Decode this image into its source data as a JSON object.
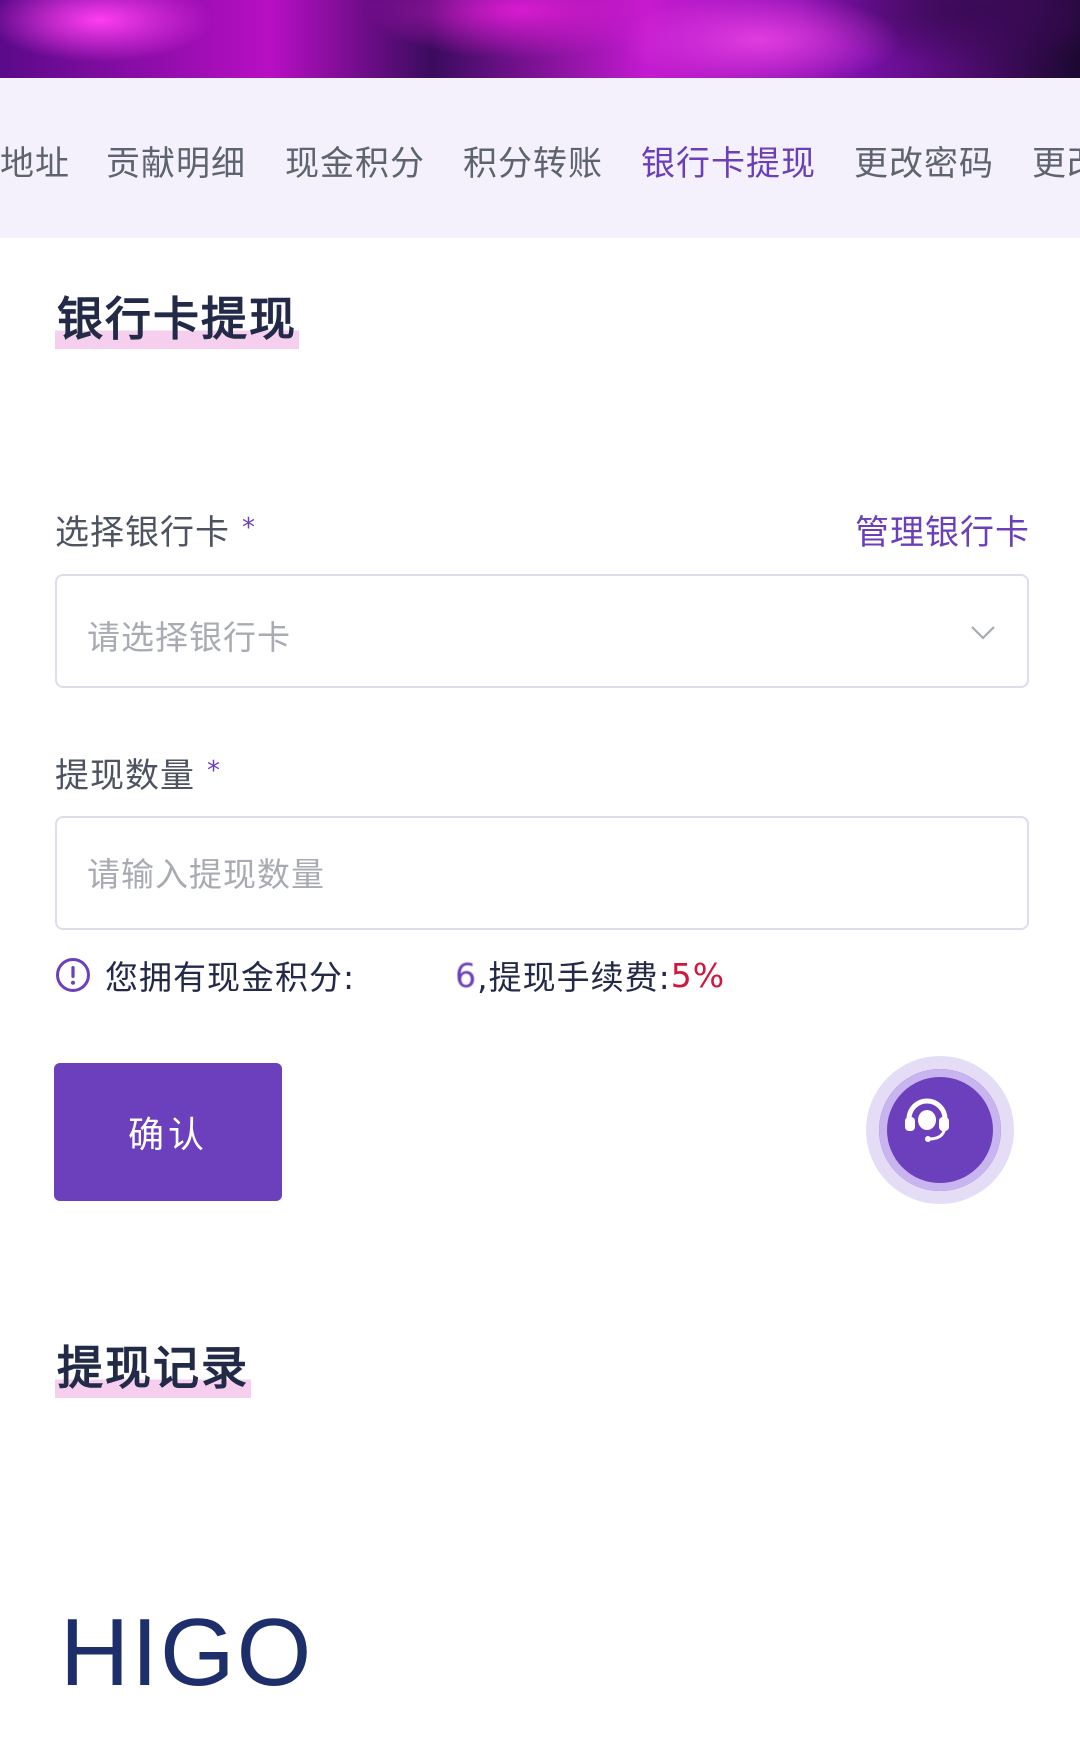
{
  "tabs": [
    {
      "label": "地址"
    },
    {
      "label": "贡献明细"
    },
    {
      "label": "现金积分"
    },
    {
      "label": "积分转账"
    },
    {
      "label": "银行卡提现"
    },
    {
      "label": "更改密码"
    },
    {
      "label": "更改"
    }
  ],
  "active_tab": "银行卡提现",
  "page_title": "银行卡提现",
  "bank_card": {
    "label": "选择银行卡",
    "required_mark": "*",
    "manage_link": "管理银行卡",
    "placeholder": "请选择银行卡"
  },
  "amount": {
    "label": "提现数量",
    "required_mark": "*",
    "placeholder": "请输入提现数量"
  },
  "info": {
    "prefix": "您拥有现金积分:",
    "value_visible": "6",
    "separator": ",提现手续费:",
    "fee": "5%"
  },
  "confirm_button": "确认",
  "records_title": "提现记录",
  "footer_logo": "HIGO",
  "colors": {
    "accent": "#6c3fbd",
    "fee": "#d0163f",
    "title": "#222a48"
  }
}
